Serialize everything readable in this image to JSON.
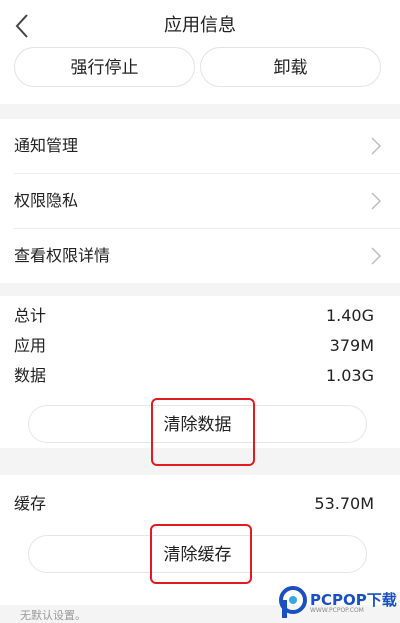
{
  "header": {
    "title": "应用信息"
  },
  "top_actions": {
    "force_stop_label": "强行停止",
    "uninstall_label": "卸载"
  },
  "menu": {
    "items": [
      {
        "label": "通知管理"
      },
      {
        "label": "权限隐私"
      },
      {
        "label": "查看权限详情"
      }
    ]
  },
  "storage": {
    "total_label": "总计",
    "total_value": "1.40G",
    "app_label": "应用",
    "app_value": "379M",
    "data_label": "数据",
    "data_value": "1.03G",
    "clear_data_label": "清除数据"
  },
  "cache": {
    "label": "缓存",
    "value": "53.70M",
    "clear_cache_label": "清除缓存"
  },
  "footer": {
    "note": "无默认设置。"
  },
  "watermark": {
    "brand": "PCPOP下载",
    "sub": "WWW.PCPOP.COM"
  },
  "colors": {
    "highlight": "#e21b23",
    "brand_blue": "#1b4fc1"
  }
}
